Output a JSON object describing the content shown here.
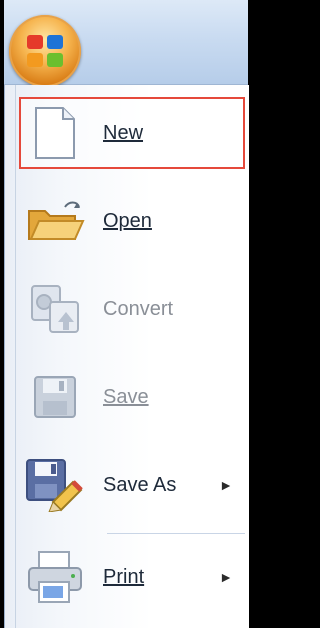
{
  "menu": {
    "items": [
      {
        "key": "new",
        "label": "New",
        "underline": "N",
        "icon": "new-document-icon",
        "enabled": true,
        "selected": true
      },
      {
        "key": "open",
        "label": "Open",
        "underline": "O",
        "icon": "open-folder-icon",
        "enabled": true
      },
      {
        "key": "convert",
        "label": "Convert",
        "underline": "v",
        "icon": "convert-icon",
        "enabled": false
      },
      {
        "key": "save",
        "label": "Save",
        "underline": "S",
        "icon": "save-disk-icon",
        "enabled": false
      },
      {
        "key": "saveas",
        "label": "Save As",
        "underline": "A",
        "icon": "save-as-icon",
        "enabled": true,
        "submenu": true
      },
      {
        "key": "print",
        "label": "Print",
        "underline": "P",
        "icon": "printer-icon",
        "enabled": true,
        "submenu": true
      }
    ],
    "submenu_arrow": "►"
  },
  "colors": {
    "selection_outline": "#e5493b",
    "disabled_text": "#8a8f97",
    "text": "#1e2a3a"
  }
}
